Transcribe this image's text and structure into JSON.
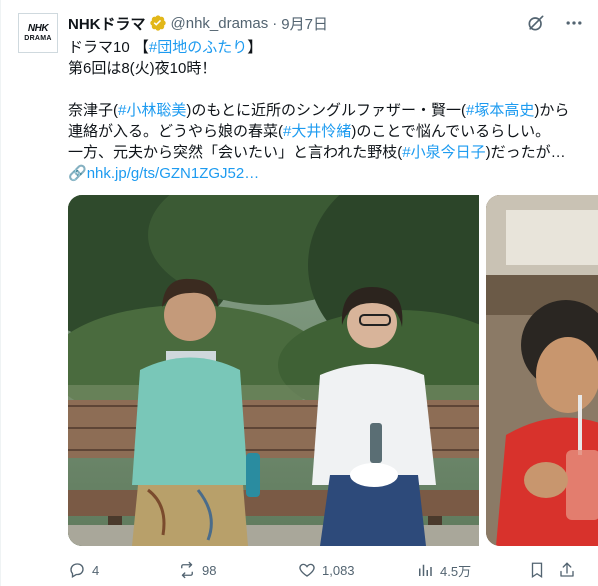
{
  "account": {
    "avatar_line1": "NHK",
    "avatar_line2": "DRAMA",
    "display_name": "NHKドラマ",
    "handle": "@nhk_dramas",
    "separator": "·",
    "date": "9月7日"
  },
  "tweet": {
    "line1_prefix": "ドラマ10 【",
    "line1_tag": "#団地のふたり",
    "line1_suffix": "】",
    "line2": "第6回は8(火)夜10時！",
    "line3_a": "奈津子(",
    "line3_tag1": "#小林聡美",
    "line3_b": ")のもとに近所のシングルファザー・賢一(",
    "line3_tag2": "#塚本高史",
    "line3_c": ")から",
    "line4_a": "連絡が入る。どうやら娘の春菜(",
    "line4_tag": "#大井怜緒",
    "line4_b": ")のことで悩んでいるらしい。",
    "line5_a": "一方、元夫から突然「会いたい」と言われた野枝(",
    "line5_tag": "#小泉今日子",
    "line5_b": ")だったが…",
    "link": "nhk.jp/g/ts/GZN1ZGJ52…"
  },
  "stats": {
    "replies": "4",
    "retweets": "98",
    "likes": "1,083",
    "views": "4.5万"
  },
  "colors": {
    "accent": "#1d9bf0",
    "verified": "#e2b719",
    "muted": "#536471"
  }
}
